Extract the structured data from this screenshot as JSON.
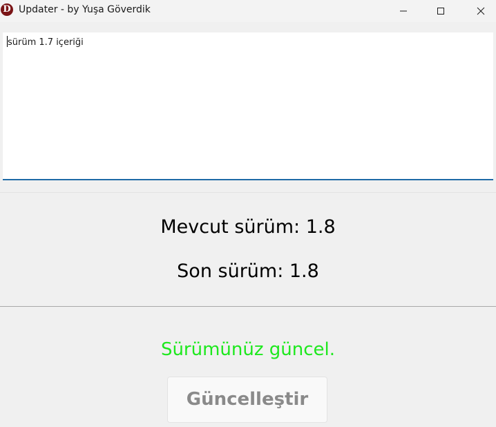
{
  "window": {
    "title": "Updater - by Yuşa Göverdik",
    "icon_letter": "D",
    "icon_color": "#7a1416",
    "controls": [
      "minimize-icon",
      "maximize-icon",
      "close-icon"
    ]
  },
  "changelog": {
    "text": "sürüm 1.7 içeriği"
  },
  "versions": {
    "current": "Mevcut sürüm: 1.8",
    "latest": "Son sürüm: 1.8"
  },
  "status": {
    "text": "Sürümünüz güncel.",
    "color": "#1ee81e"
  },
  "update_button": {
    "label": "Güncelleştir",
    "enabled": false
  }
}
